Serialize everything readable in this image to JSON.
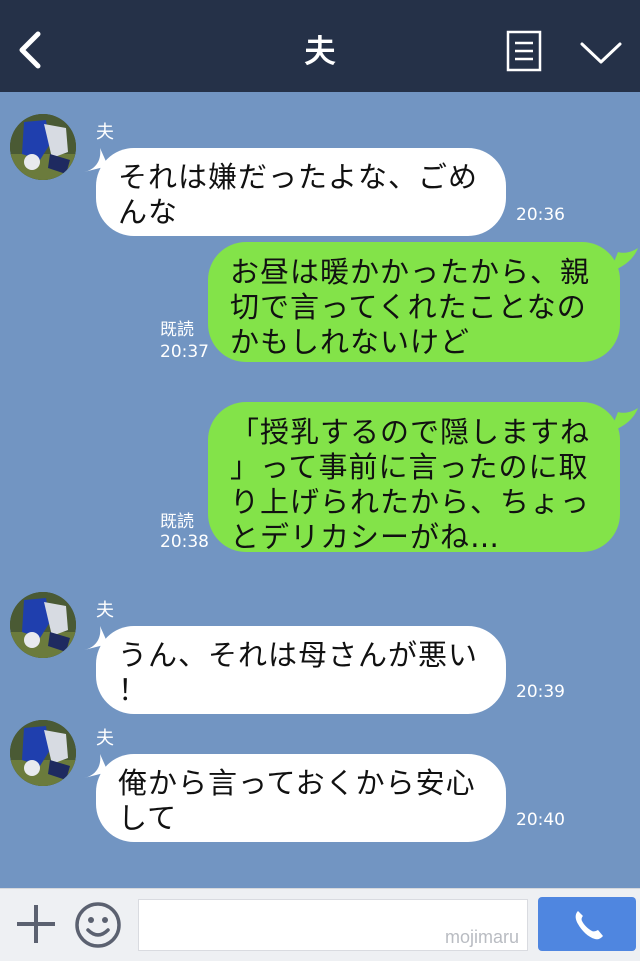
{
  "header": {
    "title": "夫",
    "colors": {
      "background": "#253148",
      "text": "#ffffff"
    },
    "icons": {
      "back": "chevron-left-icon",
      "menu": "menu-list-icon",
      "collapse": "chevron-down-icon"
    }
  },
  "chat": {
    "background": "#7295c2",
    "messages": [
      {
        "direction": "in",
        "sender": "夫",
        "lines": [
          "それは嫌だったよな、ごめ",
          "んな"
        ],
        "time": "20:36"
      },
      {
        "direction": "out",
        "read": "既読",
        "lines": [
          "お昼は暖かかったから、親",
          "切で言ってくれたことなの",
          "かもしれないけど"
        ],
        "time": "20:37"
      },
      {
        "direction": "out",
        "read": "既読",
        "lines": [
          "「授乳するので隠しますね",
          "」って事前に言ったのに取",
          "り上げられたから、ちょっ",
          "とデリカシーがね…"
        ],
        "time": "20:38"
      },
      {
        "direction": "in",
        "sender": "夫",
        "lines": [
          "うん、それは母さんが悪い",
          "！"
        ],
        "time": "20:39"
      },
      {
        "direction": "in",
        "sender": "夫",
        "lines": [
          "俺から言っておくから安心",
          "して"
        ],
        "time": "20:40"
      }
    ]
  },
  "bottombar": {
    "input_value": "",
    "watermark": "mojimaru",
    "icons": {
      "plus": "plus-icon",
      "emoji": "smiley-icon",
      "call": "phone-icon"
    },
    "call_color": "#4f86e0"
  }
}
